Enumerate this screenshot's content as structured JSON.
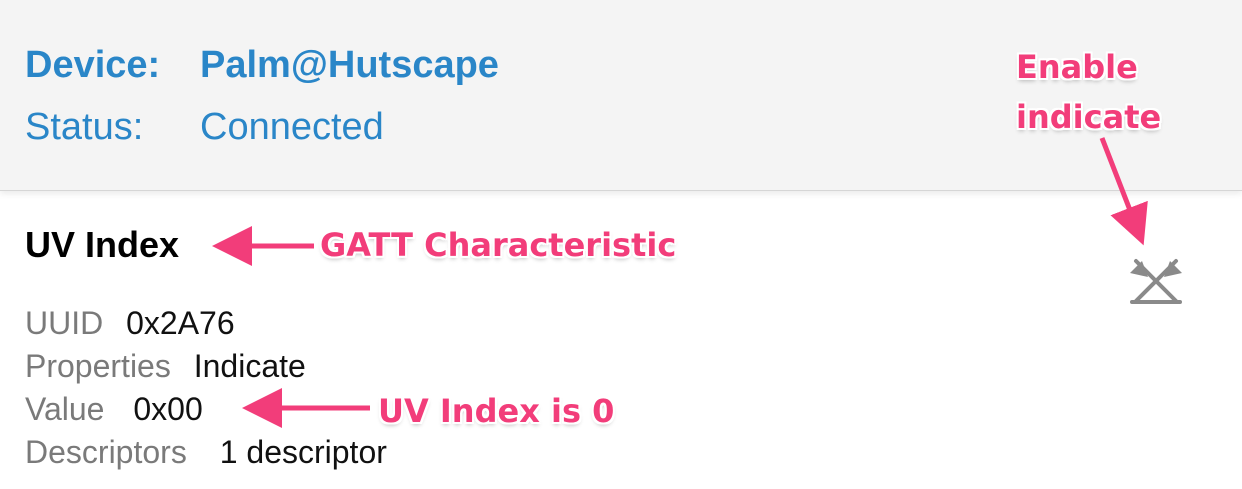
{
  "header": {
    "device_label": "Device:",
    "device_name": "Palm@Hutscape",
    "status_label": "Status:",
    "status_value": "Connected"
  },
  "characteristic": {
    "title": "UV Index",
    "uuid_label": "UUID",
    "uuid_value": "0x2A76",
    "properties_label": "Properties",
    "properties_value": "Indicate",
    "value_label": "Value",
    "value_value": "0x00",
    "descriptors_label": "Descriptors",
    "descriptors_value": "1 descriptor",
    "indicate_icon": "indicate-toggle-icon"
  },
  "annotations": {
    "enable_indicate_line1": "Enable",
    "enable_indicate_line2": "indicate",
    "gatt_characteristic": "GATT Characteristic",
    "uv_index_is_0": "UV Index is 0"
  },
  "colors": {
    "accent_blue": "#2a86c8",
    "annotation_pink": "#f23d7a",
    "icon_gray": "#8a8a8a"
  }
}
